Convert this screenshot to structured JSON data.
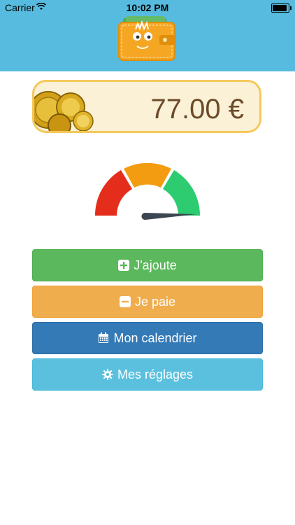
{
  "status_bar": {
    "carrier": "Carrier",
    "time": "10:02 PM"
  },
  "header": {
    "color": "#56bbde",
    "logo_icon": "wallet-face-logo"
  },
  "balance": {
    "amount": "77.00 €",
    "coins_icon": "gold-coins-image"
  },
  "gauge": {
    "segments": [
      "red",
      "orange",
      "green"
    ],
    "colors": [
      "#e52d1b",
      "#f39c12",
      "#2ecc71"
    ]
  },
  "actions": {
    "add_label": "J'ajoute",
    "pay_label": "Je paie",
    "calendar_label": "Mon calendrier",
    "settings_label": "Mes réglages"
  }
}
